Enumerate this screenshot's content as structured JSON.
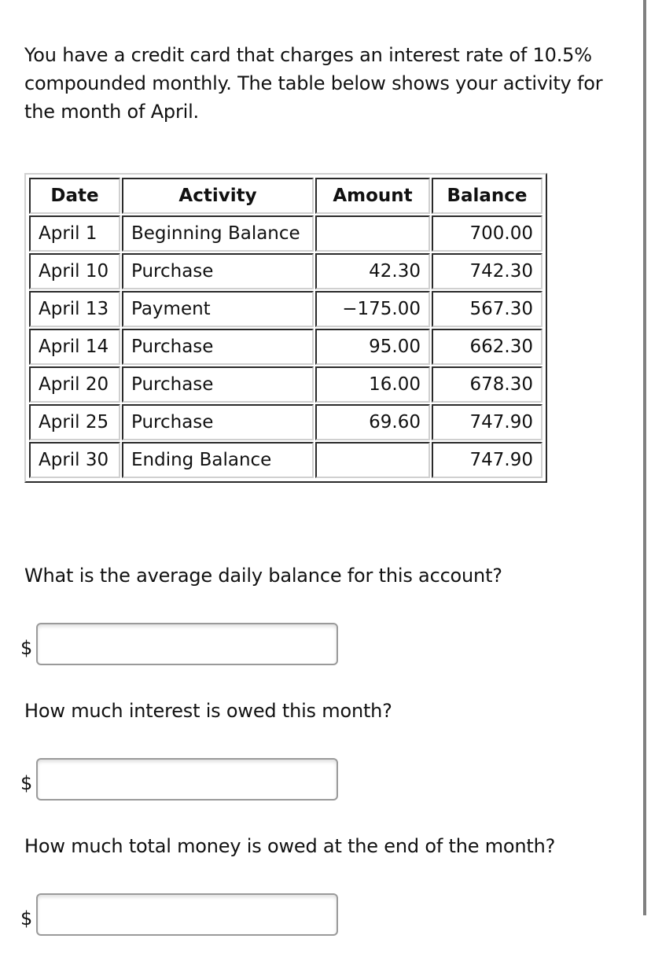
{
  "intro_text": "You have a credit card that charges an interest rate of 10.5% compounded monthly. The table below shows your activity for the month of April.",
  "table": {
    "headers": {
      "date": "Date",
      "activity": "Activity",
      "amount": "Amount",
      "balance": "Balance"
    },
    "rows": [
      {
        "date": "April 1",
        "activity": "Beginning Balance",
        "amount": "",
        "balance": "700.00"
      },
      {
        "date": "April 10",
        "activity": "Purchase",
        "amount": "42.30",
        "balance": "742.30"
      },
      {
        "date": "April 13",
        "activity": "Payment",
        "amount": "−175.00",
        "balance": "567.30"
      },
      {
        "date": "April 14",
        "activity": "Purchase",
        "amount": "95.00",
        "balance": "662.30"
      },
      {
        "date": "April 20",
        "activity": "Purchase",
        "amount": "16.00",
        "balance": "678.30"
      },
      {
        "date": "April 25",
        "activity": "Purchase",
        "amount": "69.60",
        "balance": "747.90"
      },
      {
        "date": "April 30",
        "activity": "Ending Balance",
        "amount": "",
        "balance": "747.90"
      }
    ]
  },
  "questions": [
    {
      "text": "What is the average daily balance for this account?",
      "currency": "$",
      "value": "",
      "placeholder": ""
    },
    {
      "text": "How much interest is owed this month?",
      "currency": "$",
      "value": "",
      "placeholder": ""
    },
    {
      "text": "How much total money is owed at the end of the month?",
      "currency": "$",
      "value": "",
      "placeholder": ""
    }
  ]
}
